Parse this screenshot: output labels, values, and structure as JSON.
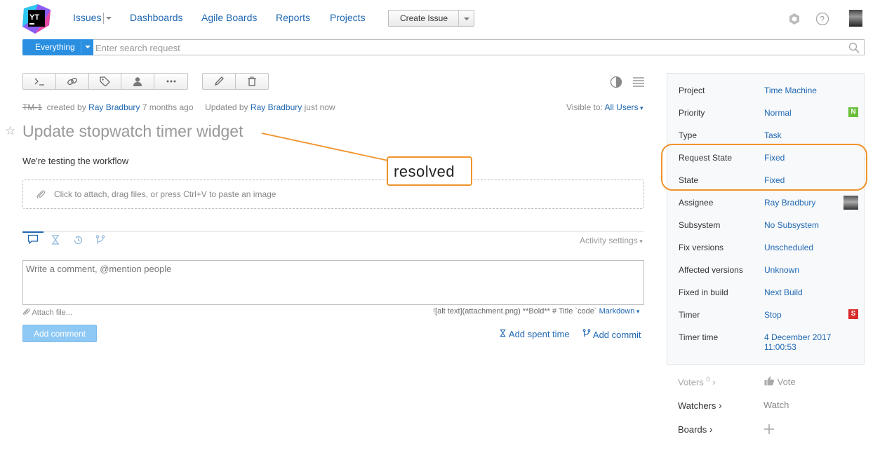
{
  "header": {
    "logo_text": "YT",
    "nav": [
      "Issues",
      "Dashboards",
      "Agile Boards",
      "Reports",
      "Projects"
    ],
    "create_issue": "Create Issue"
  },
  "search": {
    "context": "Everything",
    "placeholder": "Enter search request"
  },
  "issue": {
    "id": "TM-1",
    "created_prefix": "created by",
    "creator": "Ray Bradbury",
    "created_time": "7 months ago",
    "updated_prefix": "Updated by",
    "updater": "Ray Bradbury",
    "updated_time": "just now",
    "visible_label": "Visible to:",
    "visible_value": "All Users",
    "title": "Update stopwatch timer widget",
    "description": "We're testing the workflow",
    "attach_hint": "Click to attach, drag files, or press Ctrl+V to paste an image"
  },
  "activity": {
    "settings": "Activity settings",
    "comment_placeholder": "Write a comment, @mention people",
    "attach_file": "Attach file...",
    "markdown_hint": "![alt text](attachment.png) **Bold** # Title `code`",
    "markdown_label": "Markdown",
    "add_comment": "Add comment",
    "add_spent_time": "Add spent time",
    "add_commit": "Add commit"
  },
  "fields": [
    {
      "label": "Project",
      "value": "Time Machine"
    },
    {
      "label": "Priority",
      "value": "Normal",
      "badge": "N",
      "badge_color": "#6bbf3a"
    },
    {
      "label": "Type",
      "value": "Task"
    },
    {
      "label": "Request State",
      "value": "Fixed"
    },
    {
      "label": "State",
      "value": "Fixed"
    },
    {
      "label": "Assignee",
      "value": "Ray Bradbury"
    },
    {
      "label": "Subsystem",
      "value": "No Subsystem"
    },
    {
      "label": "Fix versions",
      "value": "Unscheduled"
    },
    {
      "label": "Affected versions",
      "value": "Unknown"
    },
    {
      "label": "Fixed in build",
      "value": "Next Build"
    },
    {
      "label": "Timer",
      "value": "Stop",
      "badge": "S",
      "badge_color": "#d92b2b"
    },
    {
      "label": "Timer time",
      "value_line1": "4 December 2017",
      "value_line2": "11:00:53"
    }
  ],
  "social": {
    "voters": "Voters",
    "voters_count": "0",
    "vote": "Vote",
    "watchers": "Watchers",
    "watch": "Watch",
    "boards": "Boards"
  },
  "annotation": {
    "text": "resolved",
    "color": "#f0932b"
  }
}
